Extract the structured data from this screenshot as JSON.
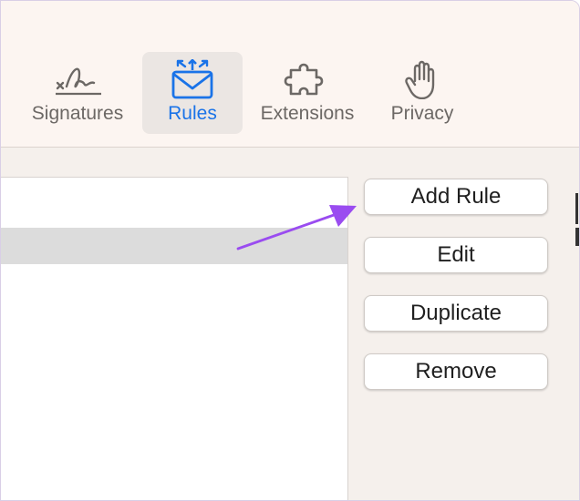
{
  "toolbar": {
    "items": [
      {
        "label": "Signatures",
        "icon": "signature-icon",
        "selected": false
      },
      {
        "label": "Rules",
        "icon": "envelope-rules-icon",
        "selected": true
      },
      {
        "label": "Extensions",
        "icon": "puzzle-icon",
        "selected": false
      },
      {
        "label": "Privacy",
        "icon": "hand-icon",
        "selected": false
      }
    ]
  },
  "rules_list": {
    "rows": [
      {
        "label": "",
        "selected": false
      },
      {
        "label": "",
        "selected": true
      }
    ]
  },
  "buttons": {
    "add_rule": "Add Rule",
    "edit": "Edit",
    "duplicate": "Duplicate",
    "remove": "Remove"
  },
  "colors": {
    "accent": "#1a73e8",
    "annotation_arrow": "#9a4cf0",
    "toolbar_bg": "#fcf5f1",
    "content_bg": "#f5f0ec",
    "selected_row": "#dcdcdc"
  }
}
